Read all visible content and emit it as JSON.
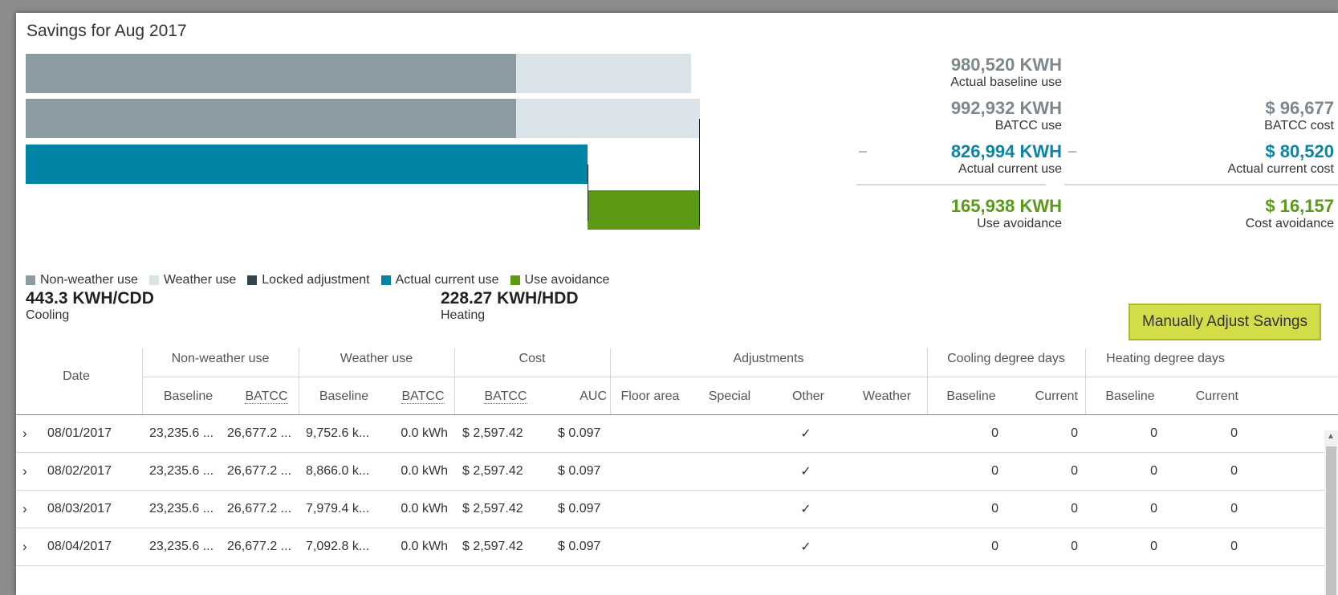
{
  "title": "Savings for Aug 2017",
  "colors": {
    "non_weather": "#8c9aa1",
    "weather": "#d9e3e8",
    "locked": "#34444d",
    "actual": "#0085a6",
    "avoidance": "#5c9a14",
    "button": "#d3dd4a"
  },
  "chart_data": {
    "type": "bar",
    "orientation": "horizontal",
    "series": [
      {
        "name": "Actual baseline use",
        "non_weather": 722000,
        "weather": 258520,
        "total": 980520
      },
      {
        "name": "BATCC use",
        "non_weather": 722000,
        "weather": 270932,
        "total": 992932
      },
      {
        "name": "Actual current use",
        "actual": 826994,
        "total": 826994
      },
      {
        "name": "Use avoidance",
        "offset": 826994,
        "avoidance": 165938,
        "total": 992932
      }
    ]
  },
  "stats": {
    "baseline_use": {
      "value": "980,520 KWH",
      "label": "Actual baseline use"
    },
    "batcc_use": {
      "value": "992,932 KWH",
      "label": "BATCC use"
    },
    "current_use": {
      "value": "826,994 KWH",
      "label": "Actual current use"
    },
    "use_avoid": {
      "value": "165,938 KWH",
      "label": "Use avoidance"
    },
    "batcc_cost": {
      "value": "$ 96,677",
      "label": "BATCC cost"
    },
    "current_cost": {
      "value": "$ 80,520",
      "label": "Actual current cost"
    },
    "cost_avoid": {
      "value": "$ 16,157",
      "label": "Cost avoidance"
    }
  },
  "legend": [
    "Non-weather use",
    "Weather use",
    "Locked adjustment",
    "Actual current use",
    "Use avoidance"
  ],
  "kpis": {
    "cooling": {
      "value": "443.3 KWH/CDD",
      "label": "Cooling"
    },
    "heating": {
      "value": "228.27 KWH/HDD",
      "label": "Heating"
    }
  },
  "button_label": "Manually Adjust Savings",
  "table": {
    "group_headers": {
      "date": "Date",
      "nonweather": "Non-weather use",
      "weather": "Weather use",
      "cost": "Cost",
      "adjustments": "Adjustments",
      "cooling": "Cooling degree days",
      "heating": "Heating degree days"
    },
    "sub_headers": {
      "nw_base": "Baseline",
      "nw_batcc": "BATCC",
      "w_base": "Baseline",
      "w_batcc": "BATCC",
      "c_batcc": "BATCC",
      "c_auc": "AUC",
      "floor": "Floor area",
      "special": "Special",
      "other": "Other",
      "weather": "Weather",
      "cdd_base": "Baseline",
      "cdd_cur": "Current",
      "hdd_base": "Baseline",
      "hdd_cur": "Current"
    },
    "rows": [
      {
        "date": "08/01/2017",
        "nw_base": "23,235.6 ...",
        "nw_batcc": "26,677.2 ...",
        "w_base": "9,752.6 k...",
        "w_batcc": "0.0 kWh",
        "c_batcc": "$ 2,597.42",
        "c_auc": "$ 0.097",
        "other": "✓",
        "cdd_base": "0",
        "cdd_cur": "0",
        "hdd_base": "0",
        "hdd_cur": "0"
      },
      {
        "date": "08/02/2017",
        "nw_base": "23,235.6 ...",
        "nw_batcc": "26,677.2 ...",
        "w_base": "8,866.0 k...",
        "w_batcc": "0.0 kWh",
        "c_batcc": "$ 2,597.42",
        "c_auc": "$ 0.097",
        "other": "✓",
        "cdd_base": "0",
        "cdd_cur": "0",
        "hdd_base": "0",
        "hdd_cur": "0"
      },
      {
        "date": "08/03/2017",
        "nw_base": "23,235.6 ...",
        "nw_batcc": "26,677.2 ...",
        "w_base": "7,979.4 k...",
        "w_batcc": "0.0 kWh",
        "c_batcc": "$ 2,597.42",
        "c_auc": "$ 0.097",
        "other": "✓",
        "cdd_base": "0",
        "cdd_cur": "0",
        "hdd_base": "0",
        "hdd_cur": "0"
      },
      {
        "date": "08/04/2017",
        "nw_base": "23,235.6 ...",
        "nw_batcc": "26,677.2 ...",
        "w_base": "7,092.8 k...",
        "w_batcc": "0.0 kWh",
        "c_batcc": "$ 2,597.42",
        "c_auc": "$ 0.097",
        "other": "✓",
        "cdd_base": "0",
        "cdd_cur": "0",
        "hdd_base": "0",
        "hdd_cur": "0"
      }
    ]
  }
}
